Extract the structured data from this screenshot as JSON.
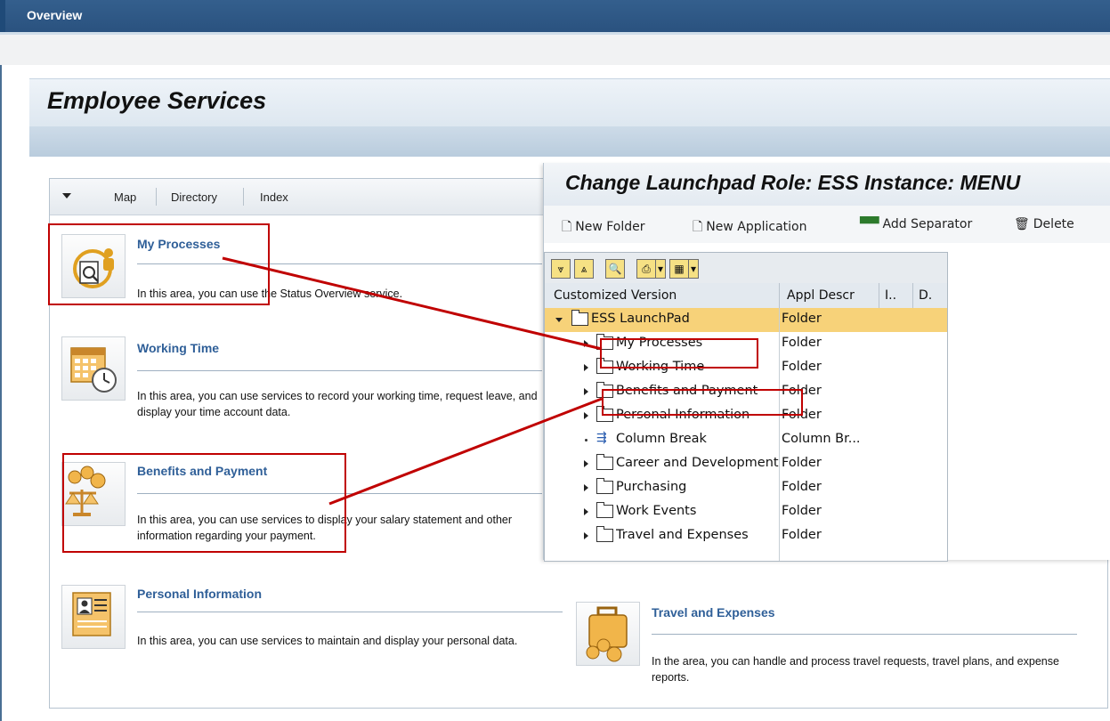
{
  "top_tab": "Overview",
  "page_title": "Employee Services",
  "nav": {
    "map": "Map",
    "directory": "Directory",
    "index": "Index"
  },
  "services": [
    {
      "title": "My Processes",
      "desc": "In this area, you can use the Status Overview service.",
      "icon": "processes-icon"
    },
    {
      "title": "Working Time",
      "desc": "In this area, you can use services to record your working time, request leave, and display your time account data.",
      "icon": "calendar-clock-icon"
    },
    {
      "title": "Benefits and Payment",
      "desc": "In this area, you can use services to display your salary statement and other information regarding your payment.",
      "icon": "scales-coins-icon"
    },
    {
      "title": "Personal Information",
      "desc": "In this area, you can use services to maintain and display your personal data.",
      "icon": "id-card-icon"
    },
    {
      "title": "Travel and Expenses",
      "desc": "In the area, you can handle and process travel requests, travel plans, and expense reports.",
      "icon": "suitcase-coins-icon"
    }
  ],
  "popup": {
    "title": "Change Launchpad Role: ESS Instance: MENU",
    "toolbar": {
      "new_folder": "New Folder",
      "new_application": "New Application",
      "add_separator": "Add Separator",
      "delete": "Delete"
    },
    "columns": {
      "version": "Customized Version",
      "appl_descr": "Appl Descr",
      "i": "I..",
      "d": "D."
    },
    "rows": [
      {
        "name": "ESS LaunchPad",
        "desc": "Folder"
      },
      {
        "name": "My Processes",
        "desc": "Folder"
      },
      {
        "name": "Working Time",
        "desc": "Folder"
      },
      {
        "name": "Benefits and Payment",
        "desc": "Folder"
      },
      {
        "name": "Personal Information",
        "desc": "Folder"
      },
      {
        "name": "Column Break",
        "desc": "Column Br..."
      },
      {
        "name": "Career and Development",
        "desc": "Folder"
      },
      {
        "name": "Purchasing",
        "desc": "Folder"
      },
      {
        "name": "Work Events",
        "desc": "Folder"
      },
      {
        "name": "Travel and Expenses",
        "desc": "Folder"
      }
    ]
  },
  "colors": {
    "topbar": "#2f5a88",
    "link_blue": "#2f5f98",
    "highlight_red": "#c00000",
    "selected_row": "#f7d279"
  }
}
